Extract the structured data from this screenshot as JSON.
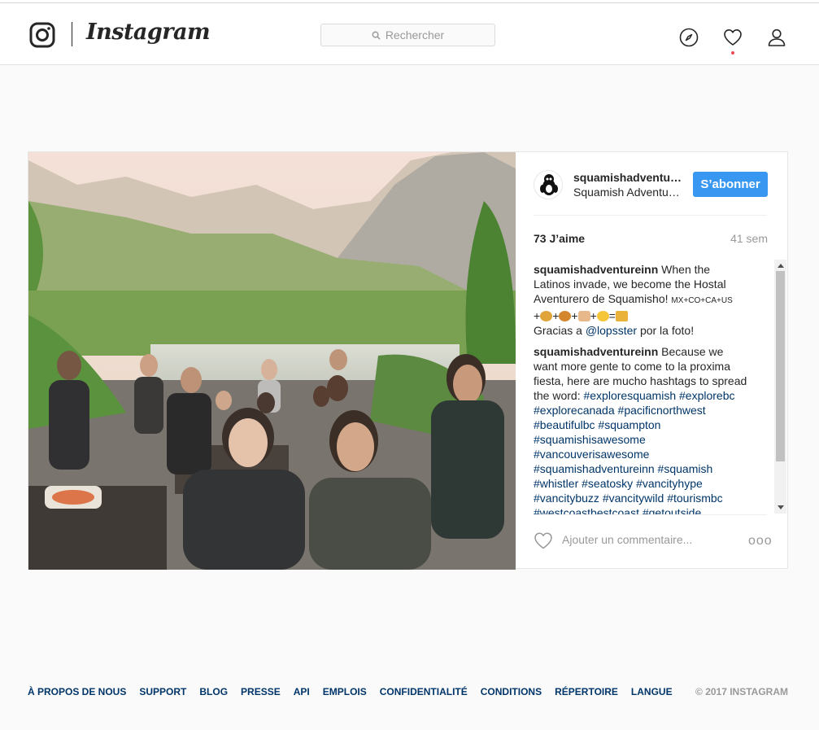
{
  "header": {
    "wordmark": "Instagram",
    "search_placeholder": "Rechercher",
    "icons": [
      "instagram-logo-icon",
      "explore-compass-icon",
      "activity-heart-icon",
      "profile-person-icon"
    ]
  },
  "post": {
    "username": "squamishadventureinn",
    "full_name": "Squamish Adventure Inn",
    "follow_label": "S’abonner",
    "likes": "73 J’aime",
    "time": "41 sem",
    "caption": {
      "user": "squamishadventureinn",
      "text": "When the Latinos invade, we become the Hostal Aventurero de Squamisho!",
      "flags": [
        "MX",
        "+",
        "CO",
        "+",
        "CA",
        "+",
        "US"
      ],
      "emoji_line": [
        "taco",
        "burger",
        "burrito",
        "sunglasses-face",
        "party-popper"
      ],
      "emoji_ops": [
        "+",
        "+",
        "+",
        "+",
        "="
      ],
      "credit_pre": "Gracias a",
      "credit_user": "@lopsster",
      "credit_post": "por la foto!"
    },
    "comment2": {
      "user": "squamishadventureinn",
      "text": "Because we want more gente to come to la proxima fiesta, here are mucho hashtags to spread the word:",
      "hashtags": [
        "#exploresquamish",
        "#explorebc",
        "#explorecanada",
        "#pacificnorthwest",
        "#beautifulbc",
        "#squampton",
        "#squamishisawesome",
        "#vancouverisawesome",
        "#squamishadventureinn",
        "#squamish",
        "#whistler",
        "#seatosky",
        "#vancityhype",
        "#vancitybuzz",
        "#vancitywild",
        "#tourismbc",
        "#westcoastbestcoast",
        "#getoutside"
      ]
    },
    "add_comment_placeholder": "Ajouter un commentaire...",
    "more_label": "ooo"
  },
  "footer": {
    "links": [
      "À PROPOS DE NOUS",
      "SUPPORT",
      "BLOG",
      "PRESSE",
      "API",
      "EMPLOIS",
      "CONFIDENTIALITÉ",
      "CONDITIONS",
      "RÉPERTOIRE",
      "LANGUE"
    ],
    "copyright": "© 2017 INSTAGRAM"
  },
  "colors": {
    "accent": "#3897f0",
    "link": "#003569",
    "notification_dot": "#ed4956",
    "muted": "#999999"
  }
}
